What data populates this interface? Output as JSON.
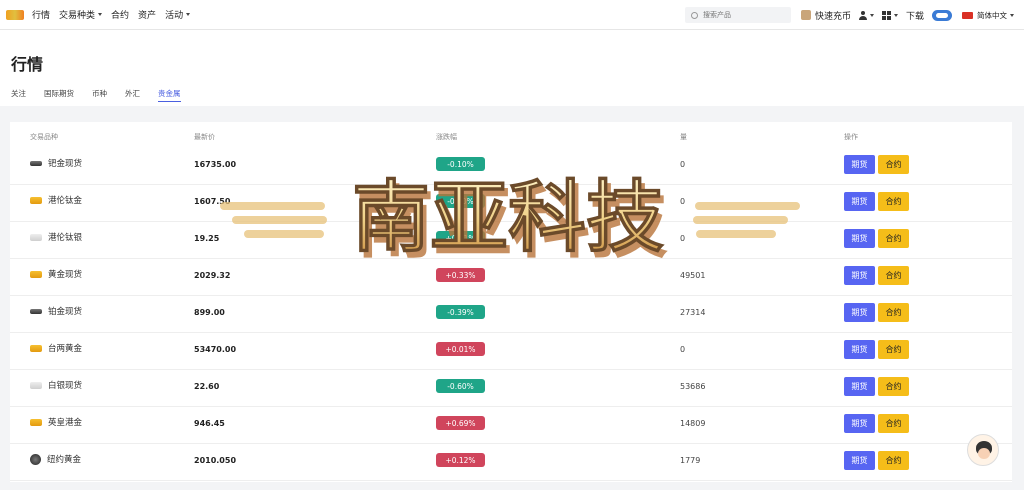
{
  "nav": {
    "items": [
      {
        "label": "行情",
        "has_caret": false
      },
      {
        "label": "交易种类",
        "has_caret": true
      },
      {
        "label": "合约",
        "has_caret": false
      },
      {
        "label": "资产",
        "has_caret": false
      },
      {
        "label": "活动",
        "has_caret": true
      }
    ],
    "search_placeholder": "搜索产品",
    "quick_charge": "快速充币",
    "download": "下载",
    "language": "简体中文"
  },
  "page": {
    "title": "行情",
    "tabs": [
      {
        "label": "关注",
        "active": false
      },
      {
        "label": "国际期货",
        "active": false
      },
      {
        "label": "币种",
        "active": false
      },
      {
        "label": "外汇",
        "active": false
      },
      {
        "label": "贵金属",
        "active": true
      }
    ]
  },
  "table": {
    "headers": {
      "name": "交易品种",
      "price": "最新价",
      "change": "涨跌幅",
      "volume": "量",
      "ops": "操作"
    },
    "futures_label": "期货",
    "contract_label": "合约",
    "rows": [
      {
        "name": "钯金现货",
        "icon": "dark",
        "price": "16735.00",
        "change": "-0.10%",
        "dir": "down",
        "volume": "0"
      },
      {
        "name": "港伦钛金",
        "icon": "gold",
        "price": "1607.50",
        "change": "-0.10%",
        "dir": "down",
        "volume": "0"
      },
      {
        "name": "港伦钛银",
        "icon": "silver",
        "price": "19.25",
        "change": "+0.21%",
        "dir": "down",
        "volume": "0"
      },
      {
        "name": "黄金现货",
        "icon": "gold",
        "price": "2029.32",
        "change": "+0.33%",
        "dir": "up",
        "volume": "49501"
      },
      {
        "name": "铂金现货",
        "icon": "dark",
        "price": "899.00",
        "change": "-0.39%",
        "dir": "down",
        "volume": "27314"
      },
      {
        "name": "台两黄金",
        "icon": "gold",
        "price": "53470.00",
        "change": "+0.01%",
        "dir": "up",
        "volume": "0"
      },
      {
        "name": "白银现货",
        "icon": "silver",
        "price": "22.60",
        "change": "-0.60%",
        "dir": "down",
        "volume": "53686"
      },
      {
        "name": "英皇港金",
        "icon": "gold",
        "price": "946.45",
        "change": "+0.69%",
        "dir": "up",
        "volume": "14809"
      },
      {
        "name": "纽约黄金",
        "icon": "coin",
        "price": "2010.050",
        "change": "+0.12%",
        "dir": "up",
        "volume": "1779"
      }
    ]
  },
  "watermark": {
    "text": "南亚科技"
  },
  "colors": {
    "accent": "#4a5fe0",
    "up": "#d0455c",
    "down": "#1fa588",
    "futures_btn": "#5765f2",
    "contract_btn": "#f5bd19"
  }
}
